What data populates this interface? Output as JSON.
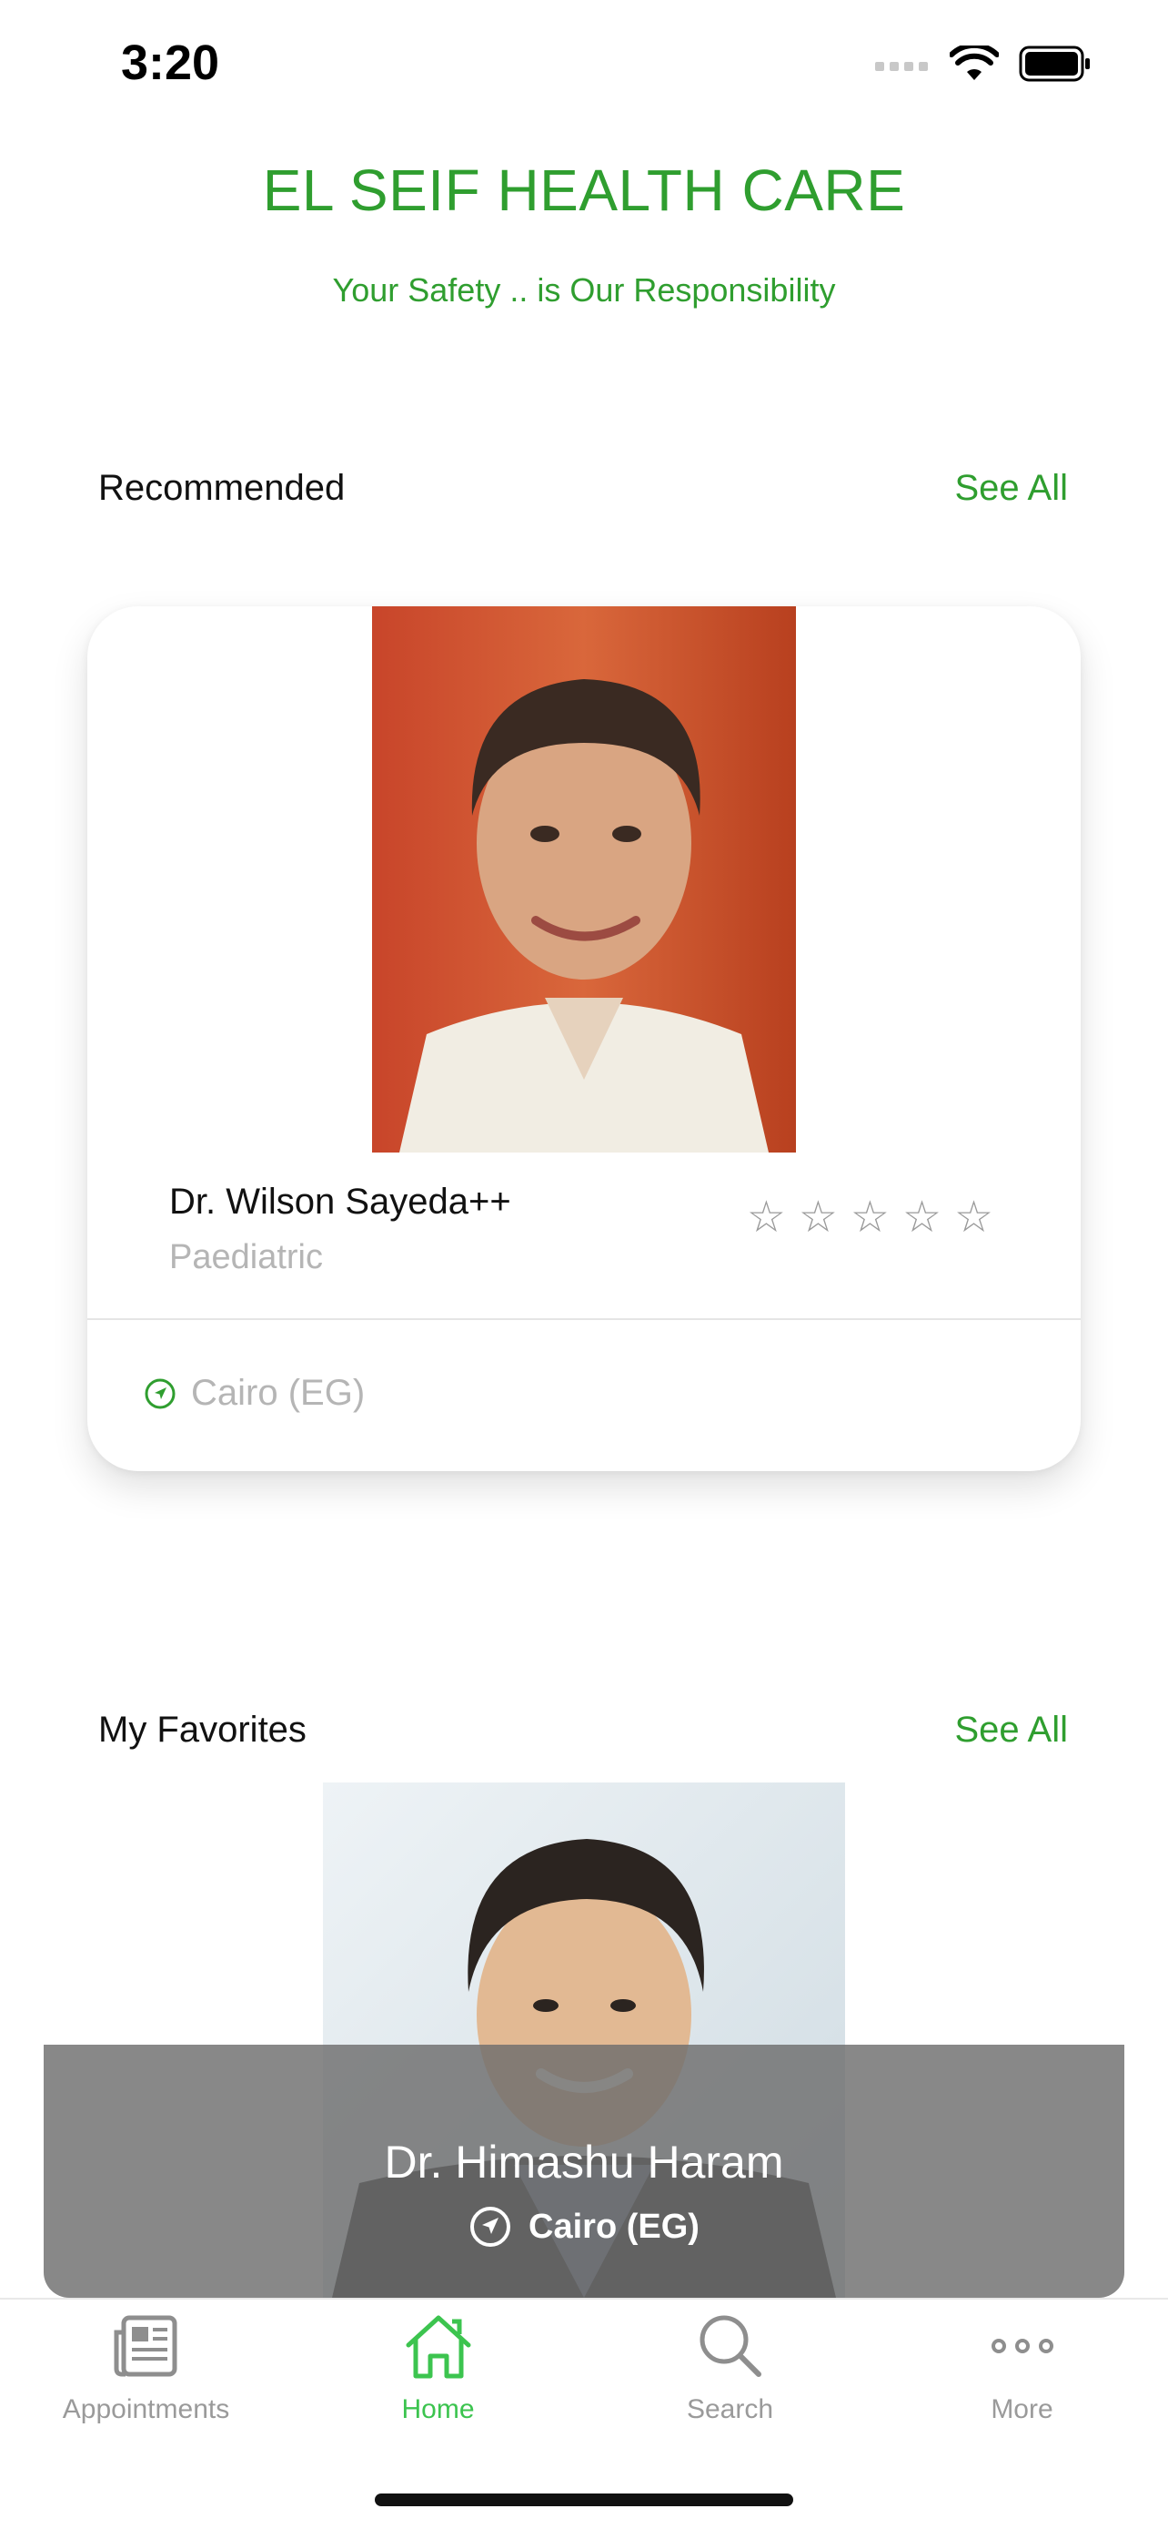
{
  "status_bar": {
    "time": "3:20"
  },
  "header": {
    "brand": "EL SEIF HEALTH CARE",
    "tagline": "Your Safety .. is Our Responsibility"
  },
  "recommended": {
    "title": "Recommended",
    "see_all": "See All",
    "card": {
      "name": "Dr. Wilson Sayeda++",
      "specialty": "Paediatric",
      "rating": 0,
      "rating_max": 5,
      "location": "Cairo (EG)"
    }
  },
  "favorites": {
    "title": "My Favorites",
    "see_all": "See All",
    "card": {
      "name": "Dr. Himashu Haram",
      "location": "Cairo (EG)"
    }
  },
  "tabbar": {
    "items": [
      {
        "label": "Appointments",
        "icon": "newspaper-icon"
      },
      {
        "label": "Home",
        "icon": "home-icon",
        "active": true
      },
      {
        "label": "Search",
        "icon": "search-icon"
      },
      {
        "label": "More",
        "icon": "more-dots-icon"
      }
    ]
  },
  "colors": {
    "brand_green": "#2f9e2f",
    "tab_active": "#3cc44f",
    "muted_gray": "#9a9a9a"
  }
}
